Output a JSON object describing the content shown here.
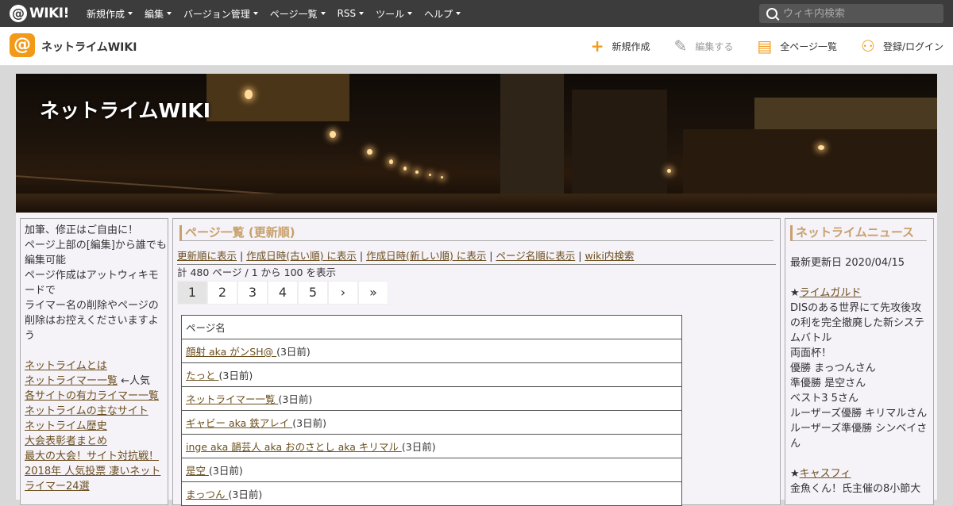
{
  "topbar": {
    "logo": "WIKI!",
    "menu": [
      "新規作成",
      "編集",
      "バージョン管理",
      "ページ一覧",
      "RSS",
      "ツール",
      "ヘルプ"
    ],
    "search_placeholder": "ウィキ内検索"
  },
  "subbar": {
    "site_name": "ネットライムWIKI",
    "actions": [
      {
        "icon": "plus-icon",
        "label": "新規作成",
        "disabled": false
      },
      {
        "icon": "pencil-icon",
        "label": "編集する",
        "disabled": true
      },
      {
        "icon": "document-icon",
        "label": "全ページ一覧",
        "disabled": false
      },
      {
        "icon": "add-user-icon",
        "label": "登録/ログイン",
        "disabled": false
      }
    ]
  },
  "banner": {
    "title": "ネットライムWIKI"
  },
  "left": {
    "intro": [
      "加筆、修正はご自由に！",
      "ページ上部の[編集]から誰でも編集可能",
      "ページ作成はアットウィキモードで",
      "ライマー名の削除やページの削除はお控えくださいますよう"
    ],
    "links": [
      {
        "text": "ネットライムとは",
        "suffix": ""
      },
      {
        "text": "ネットライマー一覧",
        "suffix": " ←人気"
      },
      {
        "text": "各サイトの有力ライマー一覧",
        "suffix": ""
      },
      {
        "text": "ネットライムの主なサイト",
        "suffix": ""
      },
      {
        "text": "ネットライム歴史",
        "suffix": ""
      },
      {
        "text": "大会表彰者まとめ",
        "suffix": ""
      },
      {
        "text": "最大の大会！サイト対抗戦！",
        "suffix": ""
      },
      {
        "text": "2018年 人気投票 凄いネットライマー24選",
        "suffix": ""
      }
    ]
  },
  "main": {
    "heading": "ページ一覧 (更新順)",
    "sort_links": [
      "更新順に表示",
      "作成日時(古い順) に表示",
      "作成日時(新しい順) に表示",
      "ページ名順に表示",
      "wiki内検索"
    ],
    "count": "計 480 ページ / 1 から 100 を表示",
    "pager": [
      "1",
      "2",
      "3",
      "4",
      "5",
      "›",
      "»"
    ],
    "table_header": "ページ名",
    "rows": [
      {
        "name": "顔射 aka がンSH@ ",
        "age": "(3日前)"
      },
      {
        "name": "たっと ",
        "age": "(3日前)"
      },
      {
        "name": "ネットライマー一覧 ",
        "age": "(3日前)"
      },
      {
        "name": "ギャビー aka 鉄アレイ ",
        "age": "(3日前)"
      },
      {
        "name": "inge aka 韻芸人 aka おのさとし aka キリマル ",
        "age": "(3日前)"
      },
      {
        "name": "是空 ",
        "age": "(3日前)"
      },
      {
        "name": "まっつん ",
        "age": "(3日前)"
      }
    ]
  },
  "right": {
    "heading": "ネットライムニュース",
    "updated": "最新更新日 2020/04/15",
    "news1_link": "ライムガルド",
    "news1_lines": [
      "DISのある世界にて先攻後攻の利を完全撤廃した新システムバトル",
      "両面杯！",
      "優勝 まっつんさん",
      "準優勝 是空さん",
      "ベスト3 5さん",
      "ルーザーズ優勝 キリマルさん",
      "ルーザーズ準優勝 シンベイさん"
    ],
    "news2_link": "キャスフィ",
    "news2_line": "金魚くん！氏主催の8小節大"
  }
}
